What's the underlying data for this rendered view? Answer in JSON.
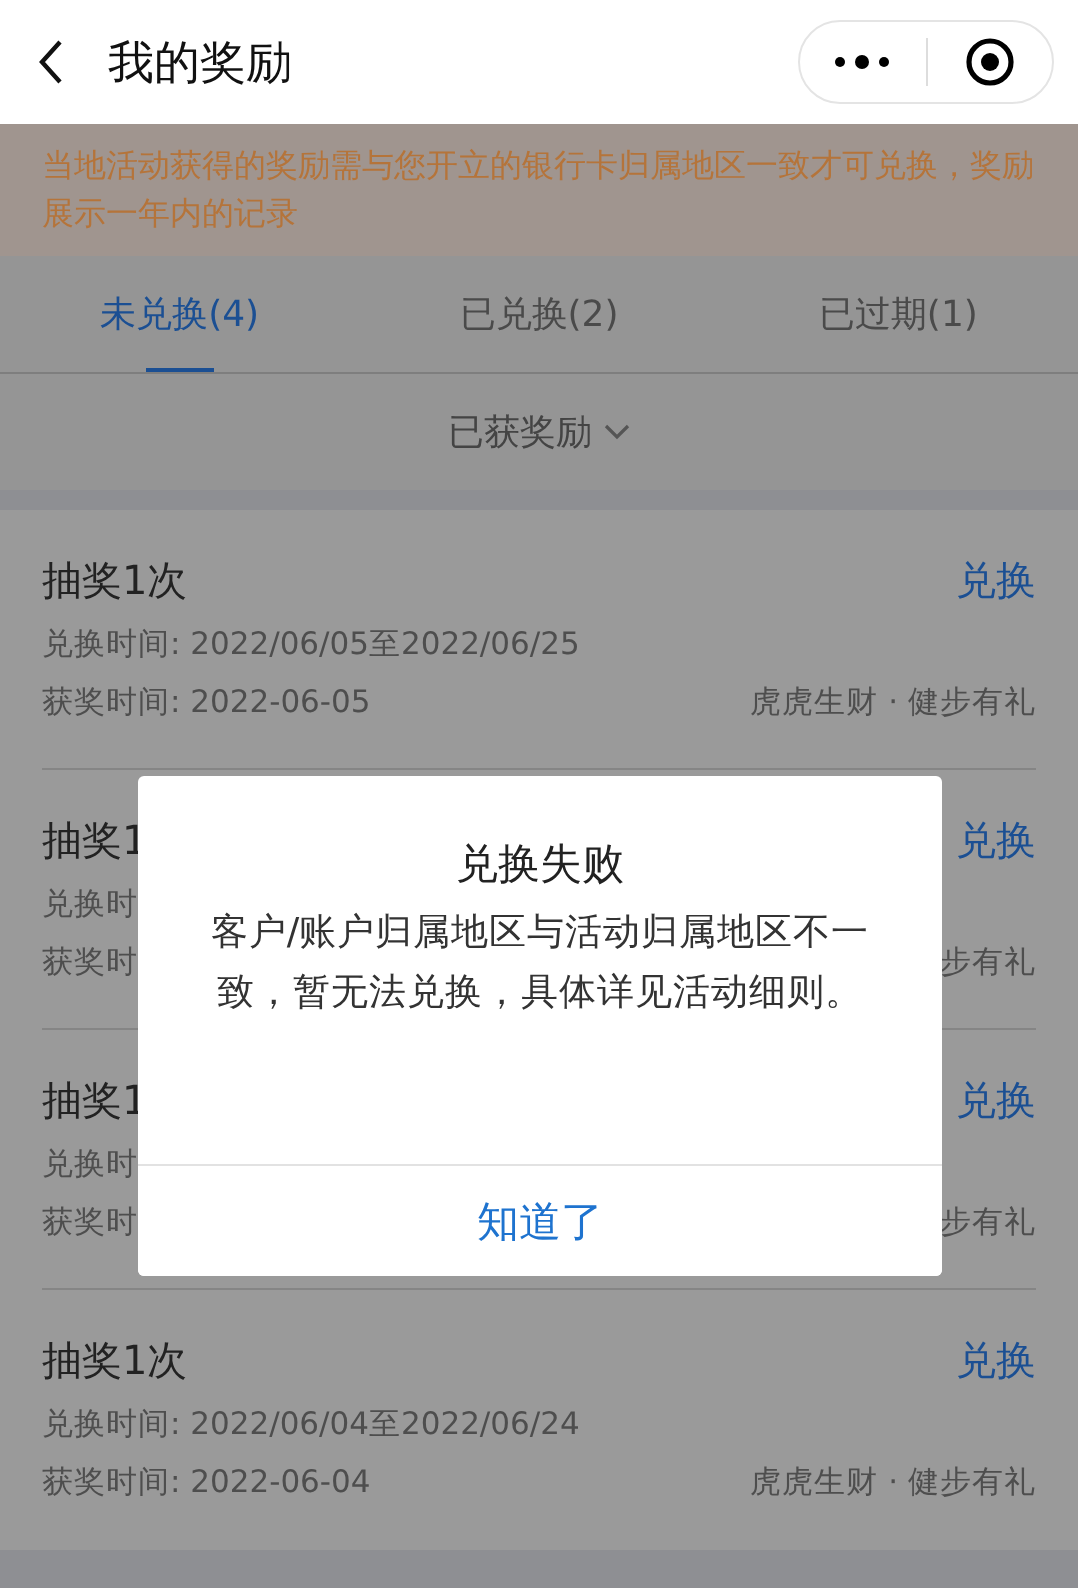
{
  "header": {
    "title": "我的奖励"
  },
  "notice": "当地活动获得的奖励需与您开立的银行卡归属地区一致才可兑换，奖励展示一年内的记录",
  "tabs": [
    {
      "label": "未兑换(4)",
      "selected": true
    },
    {
      "label": "已兑换(2)",
      "selected": false
    },
    {
      "label": "已过期(1)",
      "selected": false
    }
  ],
  "filter": {
    "label": "已获奖励"
  },
  "rewards": [
    {
      "title": "抽奖1次",
      "action": "兑换",
      "period": "兑换时间: 2022/06/05至2022/06/25",
      "won": "获奖时间: 2022-06-05",
      "source": "虎虎生财 · 健步有礼"
    },
    {
      "title": "抽奖1",
      "action": "兑换",
      "period": "兑换时",
      "won": "获奖时",
      "source": "步有礼"
    },
    {
      "title": "抽奖1",
      "action": "兑换",
      "period": "兑换时",
      "won": "获奖时",
      "source": "步有礼"
    },
    {
      "title": "抽奖1次",
      "action": "兑换",
      "period": "兑换时间: 2022/06/04至2022/06/24",
      "won": "获奖时间: 2022-06-04",
      "source": "虎虎生财 · 健步有礼"
    }
  ],
  "dialog": {
    "title": "兑换失败",
    "message": "客户/账户归属地区与活动归属地区不一致，暂无法兑换，具体详见活动细则。",
    "button": "知道了"
  }
}
